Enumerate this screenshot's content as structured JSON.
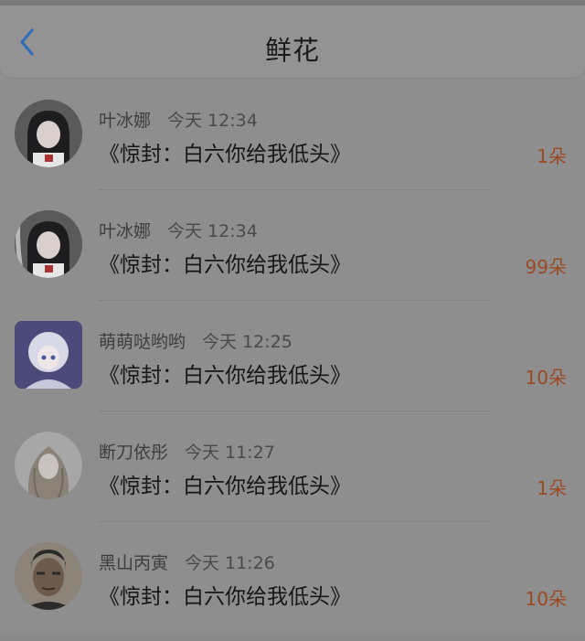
{
  "header": {
    "title": "鲜花",
    "back_icon": "chevron-left-icon"
  },
  "colors": {
    "accent": "#2f6fb8",
    "count": "#9b4a24"
  },
  "items": [
    {
      "user": "叶冰娜",
      "time": "今天 12:34",
      "work": "《惊封：白六你给我低头》",
      "count": "1朵"
    },
    {
      "user": "叶冰娜",
      "time": "今天 12:34",
      "work": "《惊封：白六你给我低头》",
      "count": "99朵"
    },
    {
      "user": "萌萌哒哟哟",
      "time": "今天 12:25",
      "work": "《惊封：白六你给我低头》",
      "count": "10朵"
    },
    {
      "user": "断刀依彤",
      "time": "今天 11:27",
      "work": "《惊封：白六你给我低头》",
      "count": "1朵"
    },
    {
      "user": "黑山丙寅",
      "time": "今天 11:26",
      "work": "《惊封：白六你给我低头》",
      "count": "10朵"
    }
  ]
}
